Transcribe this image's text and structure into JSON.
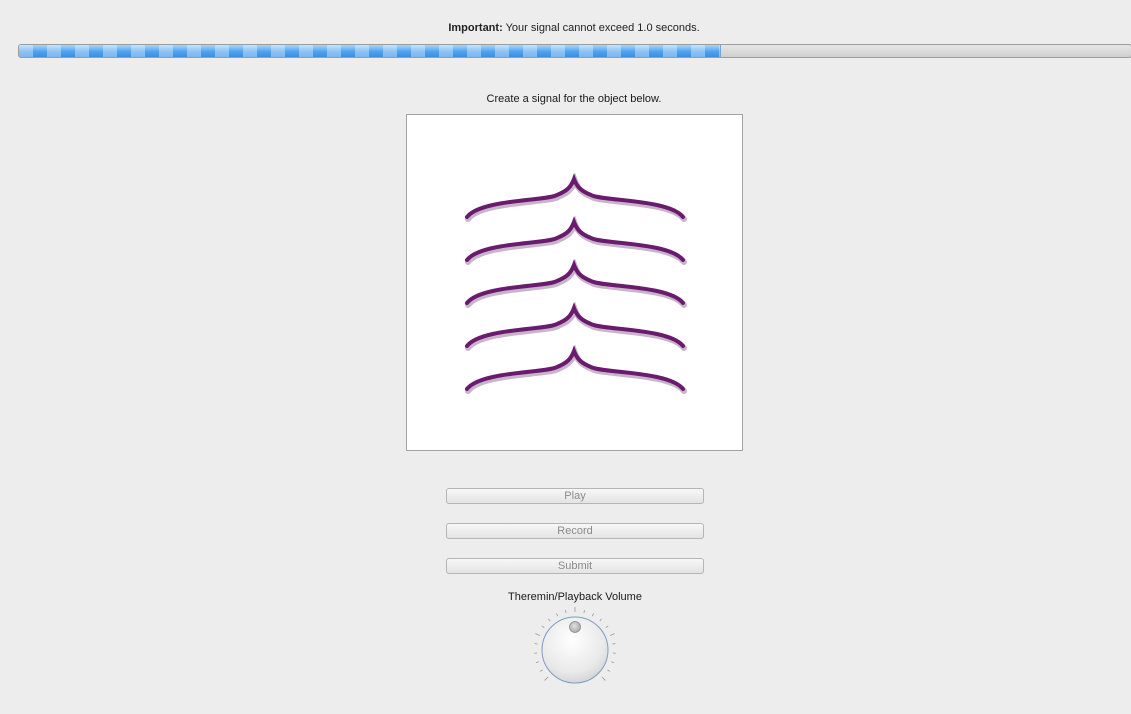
{
  "header": {
    "notice_bold": "Important:",
    "notice_text": " Your signal cannot exceed 1.0 seconds."
  },
  "progress": {
    "fraction": 0.63
  },
  "main": {
    "prompt": "Create a signal for the object below."
  },
  "stimulus": {
    "stroke_color": "#6a1b6e",
    "curve_count": 5
  },
  "buttons": {
    "play_label": "Play",
    "record_label": "Record",
    "submit_label": "Submit"
  },
  "volume": {
    "label": "Theremin/Playback Volume",
    "level": 0.5
  },
  "colors": {
    "background": "#ededed",
    "progress_fill": "#4ea3ef",
    "disabled_text": "#8a8a8a"
  }
}
